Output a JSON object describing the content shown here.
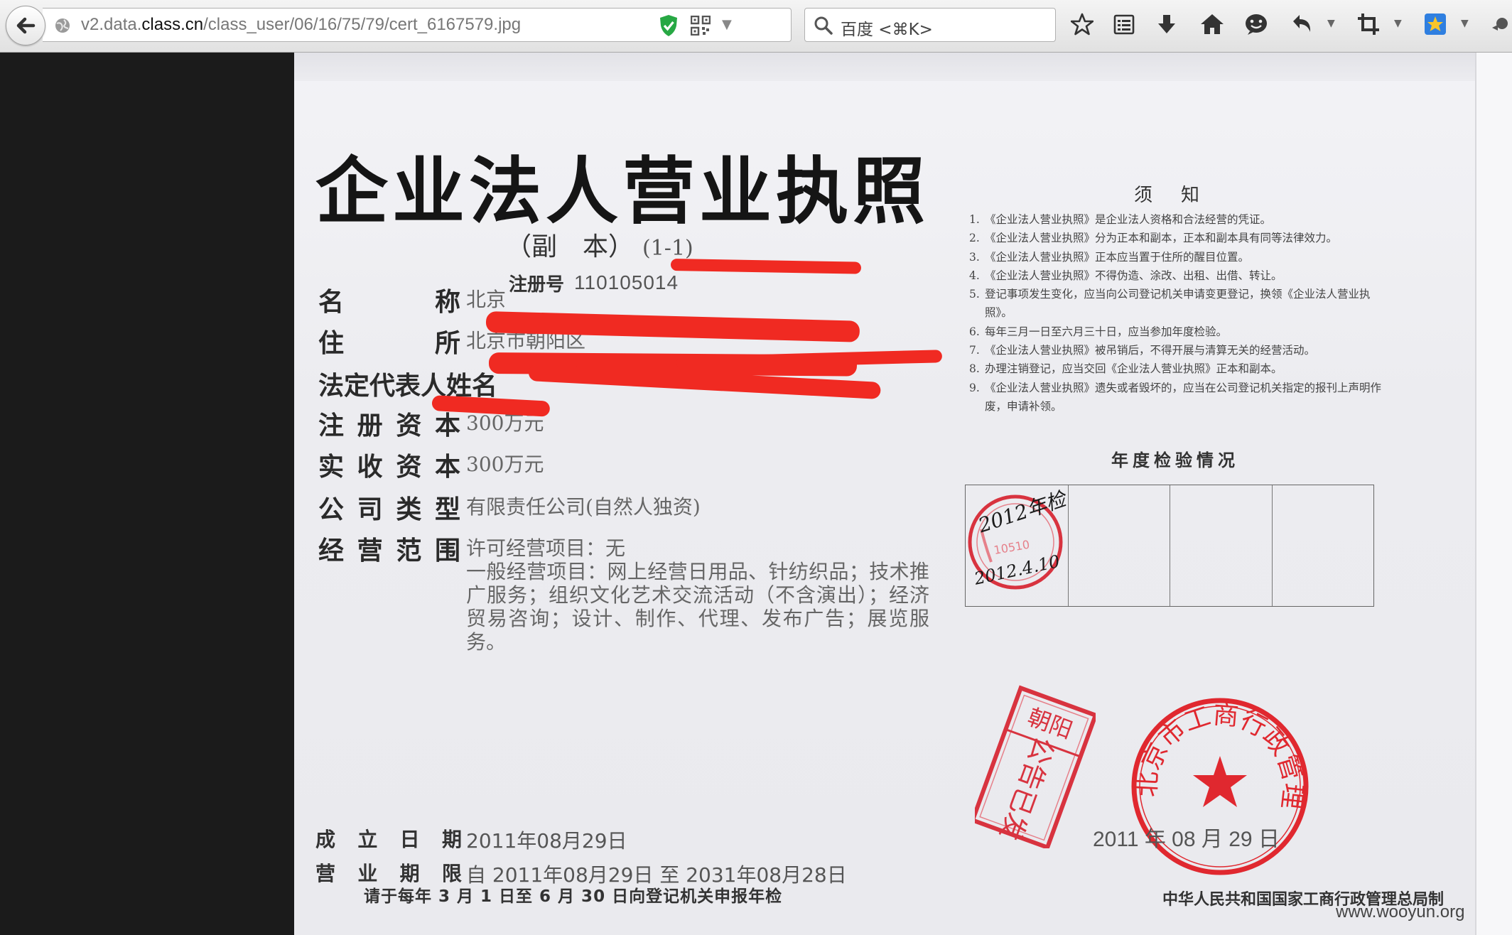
{
  "browser": {
    "url_prefix": "v2.data.",
    "url_domain": "class.cn",
    "url_path": "/class_user/06/16/75/79/cert_6167579.jpg",
    "search_placeholder": "百度 <⌘K>"
  },
  "license": {
    "title": "企业法人营业执照",
    "subtitle": "（副　本）",
    "subtitle_code": "(1-1)",
    "reg_label": "注册号",
    "reg_value": "110105014",
    "fields": [
      {
        "label": [
          "名",
          "称"
        ],
        "value": "北京"
      },
      {
        "label": [
          "住",
          "所"
        ],
        "value": "北京市朝阳区"
      },
      {
        "label": [
          "法定代表人姓名"
        ],
        "value": ""
      },
      {
        "label": [
          "注",
          "册",
          "资",
          "本"
        ],
        "value": "300万元"
      },
      {
        "label": [
          "实",
          "收",
          "资",
          "本"
        ],
        "value": "300万元"
      },
      {
        "label": [
          "公",
          "司",
          "类",
          "型"
        ],
        "value": "有限责任公司(自然人独资)"
      },
      {
        "label": [
          "经",
          "营",
          "范",
          "围"
        ],
        "value": "许可经营项目：无"
      }
    ],
    "scope_text": "一般经营项目：网上经营日用品、针纺织品；技术推广服务；组织文化艺术交流活动（不含演出）；经济贸易咨询；设计、制作、代理、发布广告；展览服务。",
    "established_label": [
      "成",
      "立",
      "日",
      "期"
    ],
    "established_value": "2011年08月29日",
    "term_label": [
      "营",
      "业",
      "期",
      "限"
    ],
    "term_value": "自 2011年08月29日 至 2031年08月28日",
    "footer_note": "请于每年 3 月 1 日至 6 月 30 日向登记机关申报年检",
    "notes_title": "须知",
    "notes": [
      {
        "n": "1.",
        "text": "《企业法人营业执照》是企业法人资格和合法经营的凭证。"
      },
      {
        "n": "2.",
        "text": "《企业法人营业执照》分为正本和副本，正本和副本具有同等法律效力。"
      },
      {
        "n": "3.",
        "text": "《企业法人营业执照》正本应当置于住所的醒目位置。"
      },
      {
        "n": "4.",
        "text": "《企业法人营业执照》不得伪造、涂改、出租、出借、转让。"
      },
      {
        "n": "5.",
        "text": "登记事项发生变化，应当向公司登记机关申请变更登记，换领《企业法人营业执照》。"
      },
      {
        "n": "6.",
        "text": "每年三月一日至六月三十日，应当参加年度检验。"
      },
      {
        "n": "7.",
        "text": "《企业法人营业执照》被吊销后，不得开展与清算无关的经营活动。"
      },
      {
        "n": "8.",
        "text": "办理注销登记，应当交回《企业法人营业执照》正本和副本。"
      },
      {
        "n": "9.",
        "text": "《企业法人营业执照》遗失或者毁坏的，应当在公司登记机关指定的报刊上声明作废，申请补领。"
      }
    ],
    "annual_title": "年度检验情况",
    "annual_stamp_year": "2012年检",
    "annual_stamp_date": "2012.4.10",
    "annual_stamp_code": "10510",
    "public_stamp_top": "朝阳",
    "public_stamp_main": "公告已发",
    "seal_text": "北京市工商行政管理局朝阳分局",
    "issue_date": "2011 年 08 月 29 日",
    "issuer": "中华人民共和国国家工商行政管理总局制",
    "watermark": "www.wooyun.org"
  },
  "colors": {
    "redaction": "#f02a22",
    "stamp_red": "#d8333f",
    "seal_red": "#e0282f"
  }
}
